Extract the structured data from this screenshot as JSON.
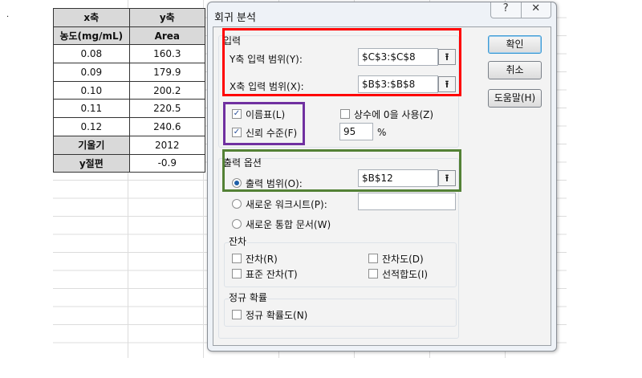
{
  "sheet": {
    "headers": [
      [
        "x축",
        "y축"
      ],
      [
        "농도(mg/mL)",
        "Area"
      ]
    ],
    "rows": [
      [
        "0.08",
        "160.3"
      ],
      [
        "0.09",
        "179.9"
      ],
      [
        "0.10",
        "200.2"
      ],
      [
        "0.11",
        "220.5"
      ],
      [
        "0.12",
        "240.6"
      ]
    ],
    "summary": [
      [
        "기울기",
        "2012"
      ],
      [
        "y절편",
        "-0.9"
      ]
    ]
  },
  "dialog": {
    "title": "회귀 분석",
    "help_glyph": "?",
    "close_glyph": "✕",
    "input": {
      "label": "입력",
      "y_label": "Y축 입력 범위(Y):",
      "y_value": "$C$3:$C$8",
      "x_label": "X축 입력 범위(X):",
      "x_value": "$B$3:$B$8"
    },
    "labels_cb": {
      "label": "이름표(L)",
      "checked": true
    },
    "confidence_cb": {
      "label": "신뢰 수준(F)",
      "checked": true
    },
    "confidence_value": "95",
    "percent": "%",
    "const_zero_cb": {
      "label": "상수에 0을 사용(Z)",
      "checked": false
    },
    "output": {
      "label": "출력 옵션",
      "range_label": "출력 범위(O):",
      "range_value": "$B$12",
      "new_sheet_label": "새로운 워크시트(P):",
      "new_sheet_value": "",
      "new_book_label": "새로운 통합 문서(W)"
    },
    "residuals": {
      "label": "잔차",
      "residuals": "잔차(R)",
      "standardized": "표준 잔차(T)",
      "residual_plots": "잔차도(D)",
      "line_fit": "선적합도(I)"
    },
    "normal": {
      "label": "정규 확률",
      "plot": "정규 확률도(N)"
    },
    "buttons": {
      "ok": "확인",
      "cancel": "취소",
      "help": "도움말(H)"
    },
    "ref_glyph": "⭱"
  },
  "colors": {
    "input_box": "#ff0000",
    "checkbox_box": "#7030a0",
    "output_box": "#538135"
  }
}
